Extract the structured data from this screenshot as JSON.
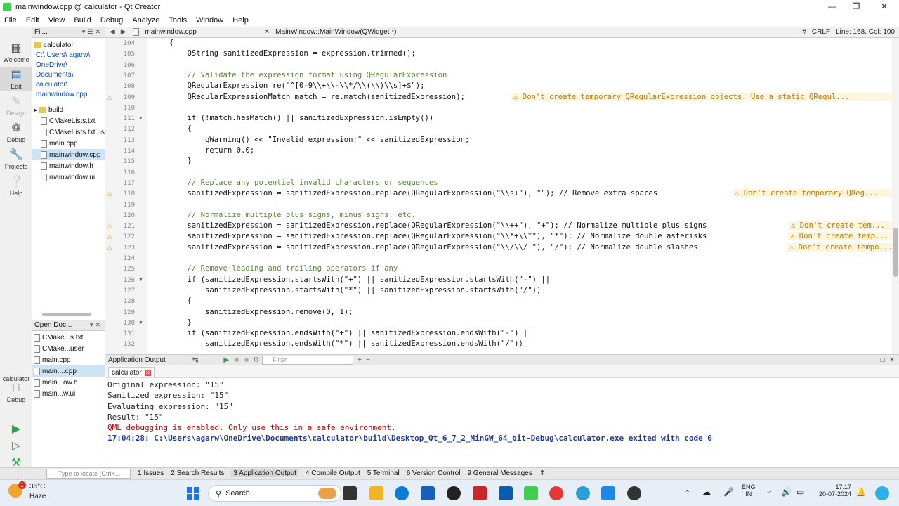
{
  "window": {
    "title": "mainwindow.cpp @ calculator - Qt Creator"
  },
  "menu": [
    "File",
    "Edit",
    "View",
    "Build",
    "Debug",
    "Analyze",
    "Tools",
    "Window",
    "Help"
  ],
  "modes": [
    {
      "label": "Welcome",
      "icon": "grid-icon"
    },
    {
      "label": "Edit",
      "icon": "edit-icon"
    },
    {
      "label": "Design",
      "icon": "design-icon"
    },
    {
      "label": "Debug",
      "icon": "bug-icon"
    },
    {
      "label": "Projects",
      "icon": "wrench-icon"
    },
    {
      "label": "Help",
      "icon": "help-icon"
    }
  ],
  "kit": {
    "label": "calculator",
    "sub": "Debug"
  },
  "projects": {
    "header": "Fil...",
    "root": "calculator",
    "path": [
      "C:\\",
      "Users\\",
      "agarw\\",
      "OneDrive\\",
      "Documents\\",
      "calculator\\",
      "mainwindow.cpp"
    ],
    "items": [
      "build",
      "CMakeLists.txt",
      "CMakeLists.txt.us",
      "main.cpp",
      "mainwindow.cpp",
      "mainwindow.h",
      "mainwindow.ui"
    ]
  },
  "open_docs": {
    "header": "Open Doc...",
    "items": [
      "CMake...s.txt",
      "CMake...user",
      "main.cpp",
      "main....cpp",
      "main...ow.h",
      "main...w.ui"
    ]
  },
  "editor": {
    "tab": "mainwindow.cpp",
    "symbol": "MainWindow::MainWindow(QWidget *)",
    "encoding": "CRLF",
    "position": "Line: 168, Col: 100",
    "line_numbers": [
      "104",
      "105",
      "106",
      "107",
      "108",
      "109",
      "110",
      "111",
      "112",
      "113",
      "114",
      "115",
      "116",
      "117",
      "118",
      "119",
      "120",
      "121",
      "122",
      "123",
      "124",
      "125",
      "126",
      "127",
      "128",
      "129",
      "130",
      "131",
      "132"
    ],
    "lines": [
      "{",
      "    QString sanitizedExpression = expression.trimmed();",
      "",
      "    // Validate the expression format using QRegularExpression",
      "    QRegularExpression re(\"^[0-9\\\\+\\\\-\\\\*/\\\\(\\\\)\\\\s]+$\");",
      "    QRegularExpressionMatch match = re.match(sanitizedExpression);",
      "",
      "    if (!match.hasMatch() || sanitizedExpression.isEmpty())",
      "    {",
      "        qWarning() << \"Invalid expression:\" << sanitizedExpression;",
      "        return 0.0;",
      "    }",
      "",
      "    // Replace any potential invalid characters or sequences",
      "    sanitizedExpression = sanitizedExpression.replace(QRegularExpression(\"\\\\s+\"), \"\"); // Remove extra spaces",
      "",
      "    // Normalize multiple plus signs, minus signs, etc.",
      "    sanitizedExpression = sanitizedExpression.replace(QRegularExpression(\"\\\\++\"), \"+\"); // Normalize multiple plus signs",
      "    sanitizedExpression = sanitizedExpression.replace(QRegularExpression(\"\\\\*+\\\\*\"), \"*\"); // Normalize double asterisks",
      "    sanitizedExpression = sanitizedExpression.replace(QRegularExpression(\"\\\\/\\\\/+\"), \"/\"); // Normalize double slashes",
      "",
      "    // Remove leading and trailing operators if any",
      "    if (sanitizedExpression.startsWith(\"+\") || sanitizedExpression.startsWith(\"-\") ||",
      "        sanitizedExpression.startsWith(\"*\") || sanitizedExpression.startsWith(\"/\"))",
      "    {",
      "        sanitizedExpression.remove(0, 1);",
      "    }",
      "    if (sanitizedExpression.endsWith(\"+\") || sanitizedExpression.endsWith(\"-\") ||",
      "        sanitizedExpression.endsWith(\"*\") || sanitizedExpression.endsWith(\"/\"))"
    ],
    "warnings": [
      "⚠ Don't create temporary QRegularExpression objects. Use a static QRegul...",
      "⚠ Don't create temporary QReg...",
      "⚠ Don't create tem...",
      "⚠ Don't create temp...",
      "⚠ Don't create tempo..."
    ]
  },
  "output": {
    "header": "Application Output",
    "filter_placeholder": "Filter",
    "tab": "calculator",
    "lines": [
      "Original expression: \"15\"",
      "Sanitized expression: \"15\"",
      "Evaluating expression: \"15\"",
      "Result: \"15\"",
      "QML debugging is enabled. Only use this in a safe environment.",
      "17:04:28: C:\\Users\\agarw\\OneDrive\\Documents\\calculator\\build\\Desktop_Qt_6_7_2_MinGW_64_bit-Debug\\calculator.exe exited with code 0"
    ]
  },
  "statusbar": {
    "locator_placeholder": "Type to locate (Ctrl+...",
    "tabs": [
      "1 Issues",
      "2 Search Results",
      "3 Application Output",
      "4 Compile Output",
      "5 Terminal",
      "6 Version Control",
      "9 General Messages"
    ]
  },
  "taskbar": {
    "weather_temp": "36°C",
    "weather_desc": "Haze",
    "weather_badge": "1",
    "search": "Search",
    "lang": "ENG",
    "region": "IN",
    "time": "17:17",
    "date": "20-07-2024"
  }
}
